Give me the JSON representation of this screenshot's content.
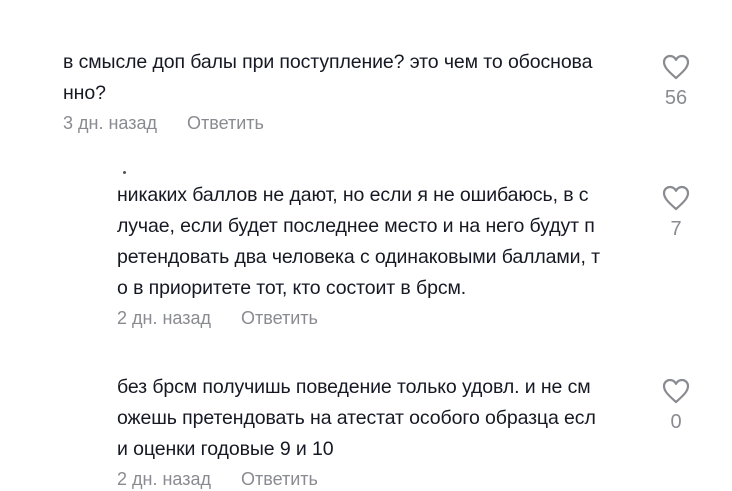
{
  "comments": [
    {
      "text": "в смысле доп балы при поступление? это чем то обоснова\nнно?",
      "time": "3 дн. назад",
      "reply_label": "Ответить",
      "likes": "56"
    },
    {
      "text": "никаких баллов не дают, но если я не ошибаюсь, в с\nлучае, если будет последнее место и на него будут п\nретендовать два человека с одинаковыми баллами, т\nо в приоритете тот, кто состоит в брсм.",
      "time": "2 дн. назад",
      "reply_label": "Ответить",
      "likes": "7"
    },
    {
      "text": "без брсм получишь поведение только удовл. и не см\nожешь претендовать на атестат особого образца есл\nи оценки годовые 9 и 10",
      "time": "2 дн. назад",
      "reply_label": "Ответить",
      "likes": "0"
    }
  ],
  "icons": {
    "like": "heart-outline-icon"
  },
  "colors": {
    "text": "#161823",
    "meta": "#8a8b91",
    "icon_stroke": "#8a8b91"
  }
}
